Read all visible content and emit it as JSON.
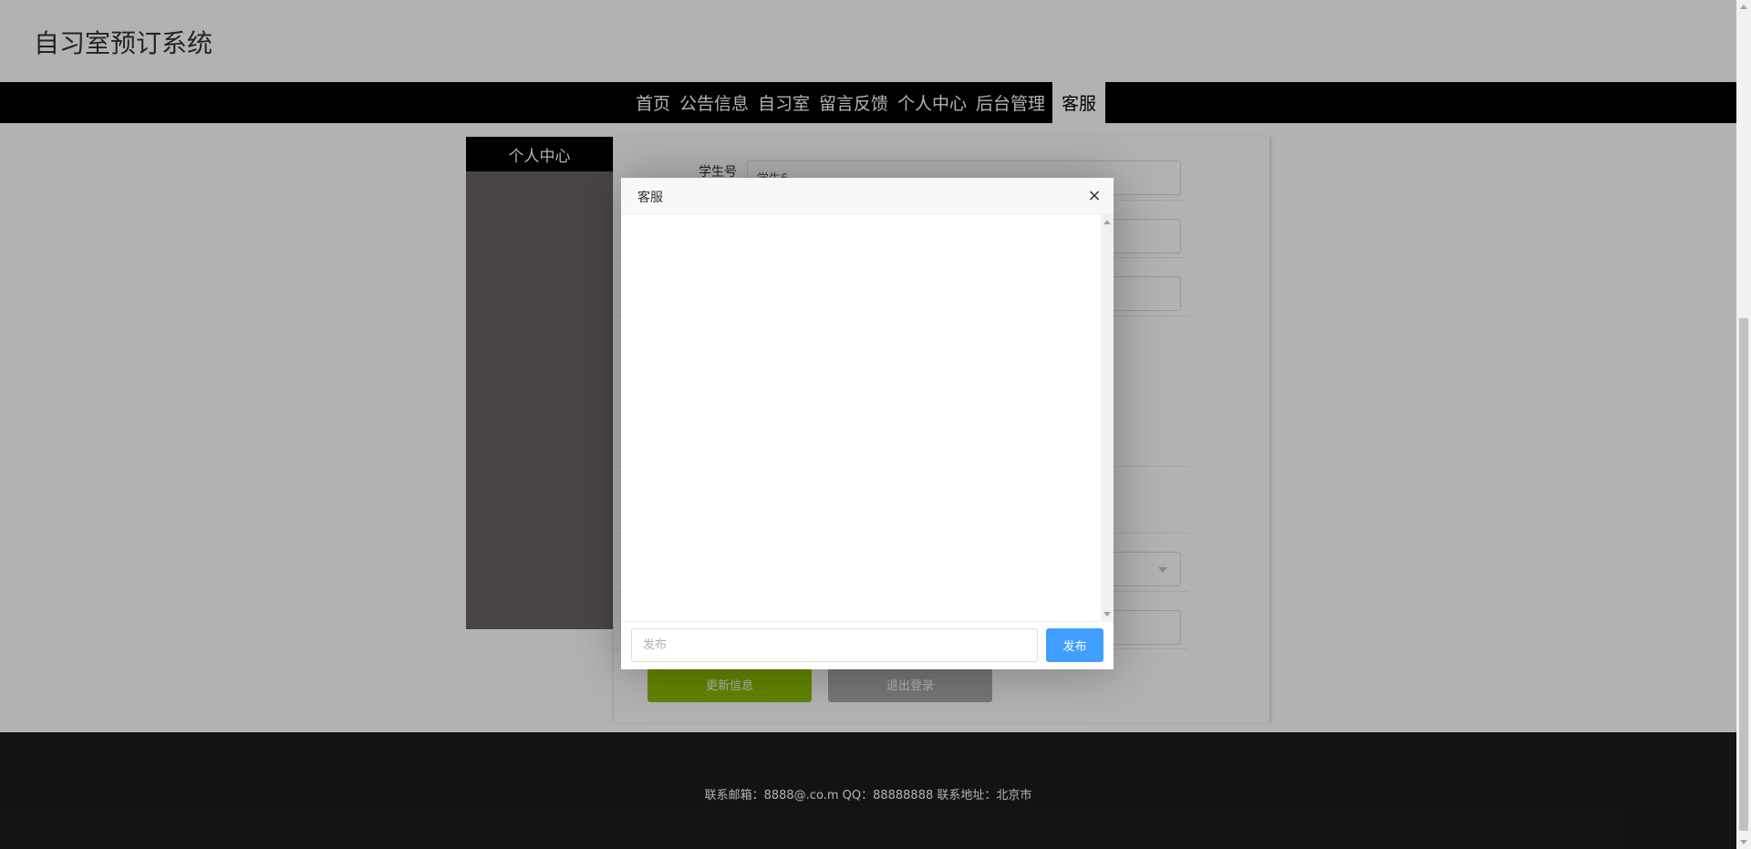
{
  "header": {
    "site_title": "自习室预订系统"
  },
  "nav": {
    "items": [
      {
        "label": "首页"
      },
      {
        "label": "公告信息"
      },
      {
        "label": "自习室"
      },
      {
        "label": "留言反馈"
      },
      {
        "label": "个人中心"
      },
      {
        "label": "后台管理"
      },
      {
        "label": "客服",
        "active": true
      }
    ]
  },
  "sidebar": {
    "title": "个人中心"
  },
  "profile_form": {
    "fields": [
      {
        "label": "学生号",
        "value": "学生6"
      }
    ],
    "update_button": "更新信息",
    "logout_button": "退出登录"
  },
  "footer": {
    "text": "联系邮箱：8888@.co.m QQ：88888888 联系地址：北京市"
  },
  "chat_modal": {
    "title": "客服",
    "close_symbol": "×",
    "input_placeholder": "发布",
    "send_label": "发布"
  },
  "colors": {
    "nav_bg": "#000000",
    "sidebar_bg": "#6c6262",
    "update_button": "#8fbd00",
    "logout_button": "#a9a9a9",
    "send_button": "#409eff",
    "footer_bg": "#1c1c1c"
  }
}
